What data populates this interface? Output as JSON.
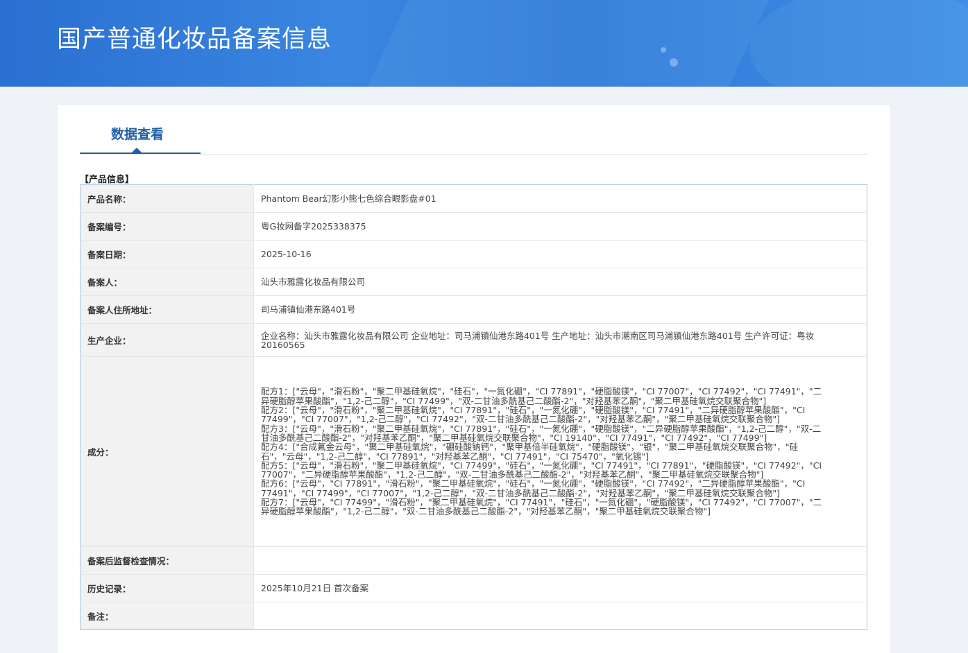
{
  "banner": {
    "title": "国产普通化妆品备案信息"
  },
  "tab": {
    "label": "数据查看"
  },
  "section": {
    "title": "【产品信息】"
  },
  "rows": {
    "product_name": {
      "label": "产品名称：",
      "value": "Phantom Bear幻影小熊七色综合眼影盘#01"
    },
    "record_no": {
      "label": "备案编号：",
      "value": "粤G妆网备字2025338375"
    },
    "record_date": {
      "label": "备案日期：",
      "value": "2025-10-16"
    },
    "registrant": {
      "label": "备案人：",
      "value": "汕头市雅露化妆品有限公司"
    },
    "registrant_address": {
      "label": "备案人住所地址：",
      "value": "司马浦镇仙港东路401号"
    },
    "manufacturer": {
      "label": "生产企业：",
      "value": "企业名称：汕头市雅露化妆品有限公司 企业地址：司马浦镇仙港东路401号 生产地址：汕头市潮南区司马浦镇仙港东路401号 生产许可证：粤妆20160565"
    },
    "ingredients": {
      "label": "成分：",
      "formulas": [
        "配方1：[\"云母\"，\"滑石粉\"，\"聚二甲基硅氧烷\"，\"硅石\"，\"一氮化硼\"，\"CI 77891\"，\"硬脂酸镁\"，\"CI 77007\"，\"CI 77492\"，\"CI 77491\"，\"二异硬脂醇苹果酸酯\"，\"1,2-己二醇\"，\"CI 77499\"，\"双-二甘油多酰基己二酸酯-2\"，\"对羟基苯乙酮\"，\"聚二甲基硅氧烷交联聚合物\"]",
        "配方2：[\"云母\"，\"滑石粉\"，\"聚二甲基硅氧烷\"，\"CI 77891\"，\"硅石\"，\"一氮化硼\"，\"硬脂酸镁\"，\"CI 77491\"，\"二异硬脂醇苹果酸酯\"，\"CI 77499\"，\"CI 77007\"，\"1,2-己二醇\"，\"CI 77492\"，\"双-二甘油多酰基己二酸酯-2\"，\"对羟基苯乙酮\"，\"聚二甲基硅氧烷交联聚合物\"]",
        "配方3：[\"云母\"，\"滑石粉\"，\"聚二甲基硅氧烷\"，\"CI 77891\"，\"硅石\"，\"一氮化硼\"，\"硬脂酸镁\"，\"二异硬脂醇苹果酸酯\"，\"1,2-己二醇\"，\"双-二甘油多酰基己二酸酯-2\"，\"对羟基苯乙酮\"，\"聚二甲基硅氧烷交联聚合物\"，\"CI 19140\"，\"CI 77491\"，\"CI 77492\"，\"CI 77499\"]",
        "配方4：[\"合成氟金云母\"，\"聚二甲基硅氧烷\"，\"硼硅酸钠钙\"，\"聚甲基倍半硅氧烷\"，\"硬脂酸镁\"，\"银\"，\"聚二甲基硅氧烷交联聚合物\"，\"硅石\"，\"云母\"，\"1,2-己二醇\"，\"CI 77891\"，\"对羟基苯乙酮\"，\"CI 77491\"，\"CI 75470\"，\"氧化锡\"]",
        "配方5：[\"云母\"，\"滑石粉\"，\"聚二甲基硅氧烷\"，\"CI 77499\"，\"硅石\"，\"一氮化硼\"，\"CI 77491\"，\"CI 77891\"，\"硬脂酸镁\"，\"CI 77492\"，\"CI 77007\"，\"二异硬脂醇苹果酸酯\"，\"1,2-己二醇\"，\"双-二甘油多酰基己二酸酯-2\"，\"对羟基苯乙酮\"，\"聚二甲基硅氧烷交联聚合物\"]",
        "配方6：[\"云母\"，\"CI 77891\"，\"滑石粉\"，\"聚二甲基硅氧烷\"，\"硅石\"，\"一氮化硼\"，\"硬脂酸镁\"，\"CI 77492\"，\"二异硬脂醇苹果酸酯\"，\"CI 77491\"，\"CI 77499\"，\"CI 77007\"，\"1,2-己二醇\"，\"双-二甘油多酰基己二酸酯-2\"，\"对羟基苯乙酮\"，\"聚二甲基硅氧烷交联聚合物\"]",
        "配方7：[\"云母\"，\"CI 77499\"，\"滑石粉\"，\"聚二甲基硅氧烷\"，\"CI 77491\"，\"硅石\"，\"一氮化硼\"，\"硬脂酸镁\"，\"CI 77492\"，\"CI 77007\"，\"二异硬脂醇苹果酸酯\"，\"1,2-己二醇\"，\"双-二甘油多酰基己二酸酯-2\"，\"对羟基苯乙酮\"，\"聚二甲基硅氧烷交联聚合物\"]"
      ]
    },
    "post_inspection": {
      "label": "备案后监督检查情况：",
      "value": ""
    },
    "history": {
      "label": "历史记录：",
      "value": "2025年10月21日 首次备案"
    },
    "remarks": {
      "label": "备注：",
      "value": ""
    }
  }
}
